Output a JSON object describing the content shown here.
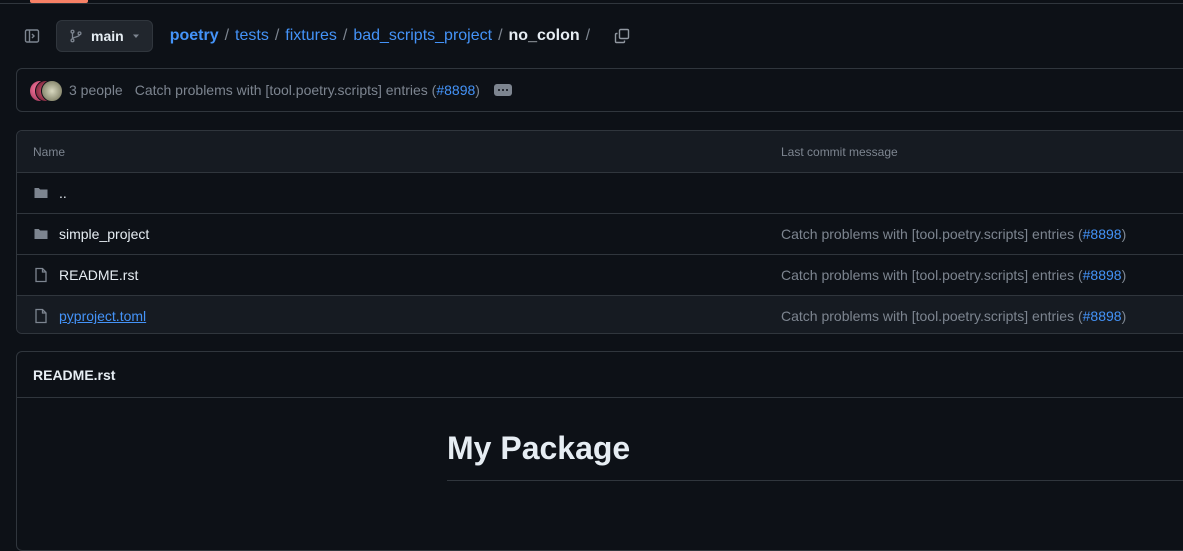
{
  "header": {
    "branch": "main",
    "breadcrumbs": [
      "poetry",
      "tests",
      "fixtures",
      "bad_scripts_project"
    ],
    "current": "no_colon",
    "trailing_sep": "/"
  },
  "commit_bar": {
    "people": "3 people",
    "message_prefix": "Catch problems with [tool.poetry.scripts] entries (",
    "pr": "#8898",
    "message_suffix": ")"
  },
  "files": {
    "headers": {
      "name": "Name",
      "last_commit": "Last commit message"
    },
    "parent": "..",
    "rows": [
      {
        "name": "simple_project",
        "type": "folder",
        "msg_prefix": "Catch problems with [tool.poetry.scripts] entries (",
        "pr": "#8898",
        "msg_suffix": ")"
      },
      {
        "name": "README.rst",
        "type": "file",
        "msg_prefix": "Catch problems with [tool.poetry.scripts] entries (",
        "pr": "#8898",
        "msg_suffix": ")"
      },
      {
        "name": "pyproject.toml",
        "type": "file",
        "msg_prefix": "Catch problems with [tool.poetry.scripts] entries (",
        "pr": "#8898",
        "msg_suffix": ")"
      }
    ]
  },
  "readme": {
    "filename": "README.rst",
    "heading": "My Package"
  },
  "colors": {
    "accent": "#4493f8",
    "bg": "#0d1117",
    "border": "#30363d",
    "muted": "#7d8590"
  }
}
